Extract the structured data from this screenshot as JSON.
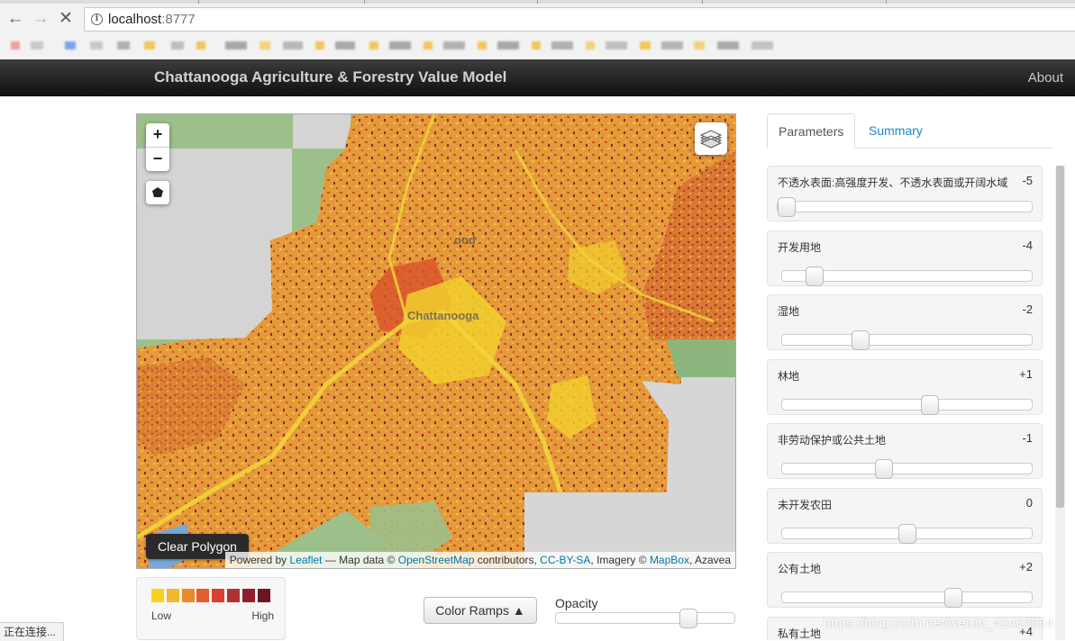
{
  "browser": {
    "url_host": "localhost",
    "url_port": ":8777",
    "back_icon": "back-arrow-icon",
    "forward_icon": "forward-arrow-icon",
    "reload_icon": "stop-loading-icon"
  },
  "navbar": {
    "brand": "Chattanooga Agriculture & Forestry Value Model",
    "about": "About"
  },
  "map": {
    "zoom_in": "+",
    "zoom_out": "−",
    "place_labels": [
      "ood",
      "Chattanooga"
    ],
    "clear_polygon": "Clear Polygon",
    "attribution": {
      "prefix": "Powered by ",
      "leaflet": "Leaflet",
      "mid1": " — Map data © ",
      "osm": "OpenStreetMap",
      "mid2": " contributors, ",
      "license": "CC-BY-SA",
      "mid3": ", Imagery © ",
      "mapbox": "MapBox",
      "suffix": ", Azavea"
    }
  },
  "legend": {
    "colors": [
      "#f6d320",
      "#f1b82e",
      "#ea8a2a",
      "#e25e2c",
      "#d8412d",
      "#b13232",
      "#8f1f2f",
      "#6e1522"
    ],
    "low": "Low",
    "high": "High"
  },
  "controls": {
    "color_ramps": "Color Ramps",
    "opacity_label": "Opacity",
    "opacity_value": 0.74
  },
  "panel": {
    "tabs": [
      "Parameters",
      "Summary"
    ],
    "slider_min": -5,
    "slider_max": 5,
    "params": [
      {
        "label": "不透水表面:高强度开发、不透水表面或开阔水域",
        "value": "-5"
      },
      {
        "label": "开发用地",
        "value": "-4"
      },
      {
        "label": "湿地",
        "value": "-2"
      },
      {
        "label": "林地",
        "value": "+1"
      },
      {
        "label": "非劳动保护或公共土地",
        "value": "-1"
      },
      {
        "label": "未开发农田",
        "value": "0"
      },
      {
        "label": "公有土地",
        "value": "+2"
      },
      {
        "label": "私有土地",
        "value": "+4"
      }
    ]
  },
  "status_bar": "正在连接...",
  "watermark": "https://blog.csdn.net/weixin_42467554"
}
